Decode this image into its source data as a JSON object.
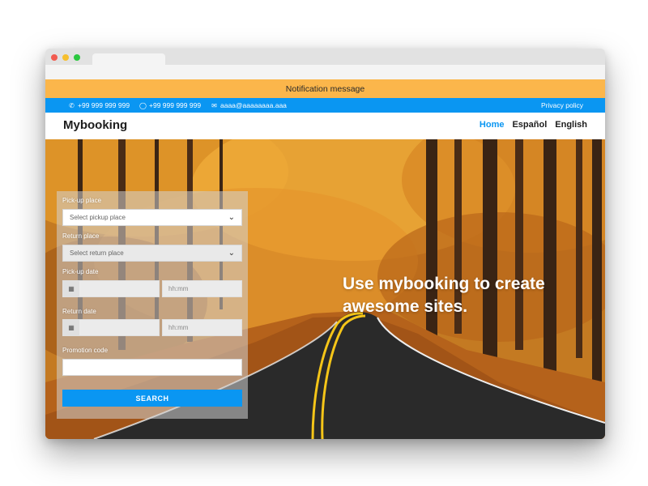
{
  "notification": {
    "text": "Notification message"
  },
  "topbar": {
    "phone": "+99 999 999 999",
    "whatsapp": "+99 999 999 999",
    "email": "aaaa@aaaaaaaa.aaa",
    "privacy": "Privacy policy",
    "phone_icon": "phone-icon",
    "whatsapp_icon": "whatsapp-icon",
    "email_icon": "envelope-icon"
  },
  "navbar": {
    "brand": "Mybooking",
    "menu": [
      "Home",
      "Español",
      "English"
    ],
    "active_item": "Home"
  },
  "form": {
    "pickup_place_label": "Pick-up place",
    "pickup_place_placeholder": "Select pickup place",
    "return_place_label": "Return place",
    "return_place_placeholder": "Select return place",
    "pickup_date_label": "Pick-up date",
    "pickup_time_placeholder": "hh:mm",
    "return_date_label": "Return date",
    "return_time_placeholder": "hh:mm",
    "promo_label": "Promotion code",
    "search_label": "SEARCH"
  },
  "hero": {
    "headline": "Use mybooking to create awesome sites."
  },
  "colors": {
    "accent": "#0a96f2",
    "notification": "#fbb64b",
    "text_dark": "#1d1d1d"
  }
}
